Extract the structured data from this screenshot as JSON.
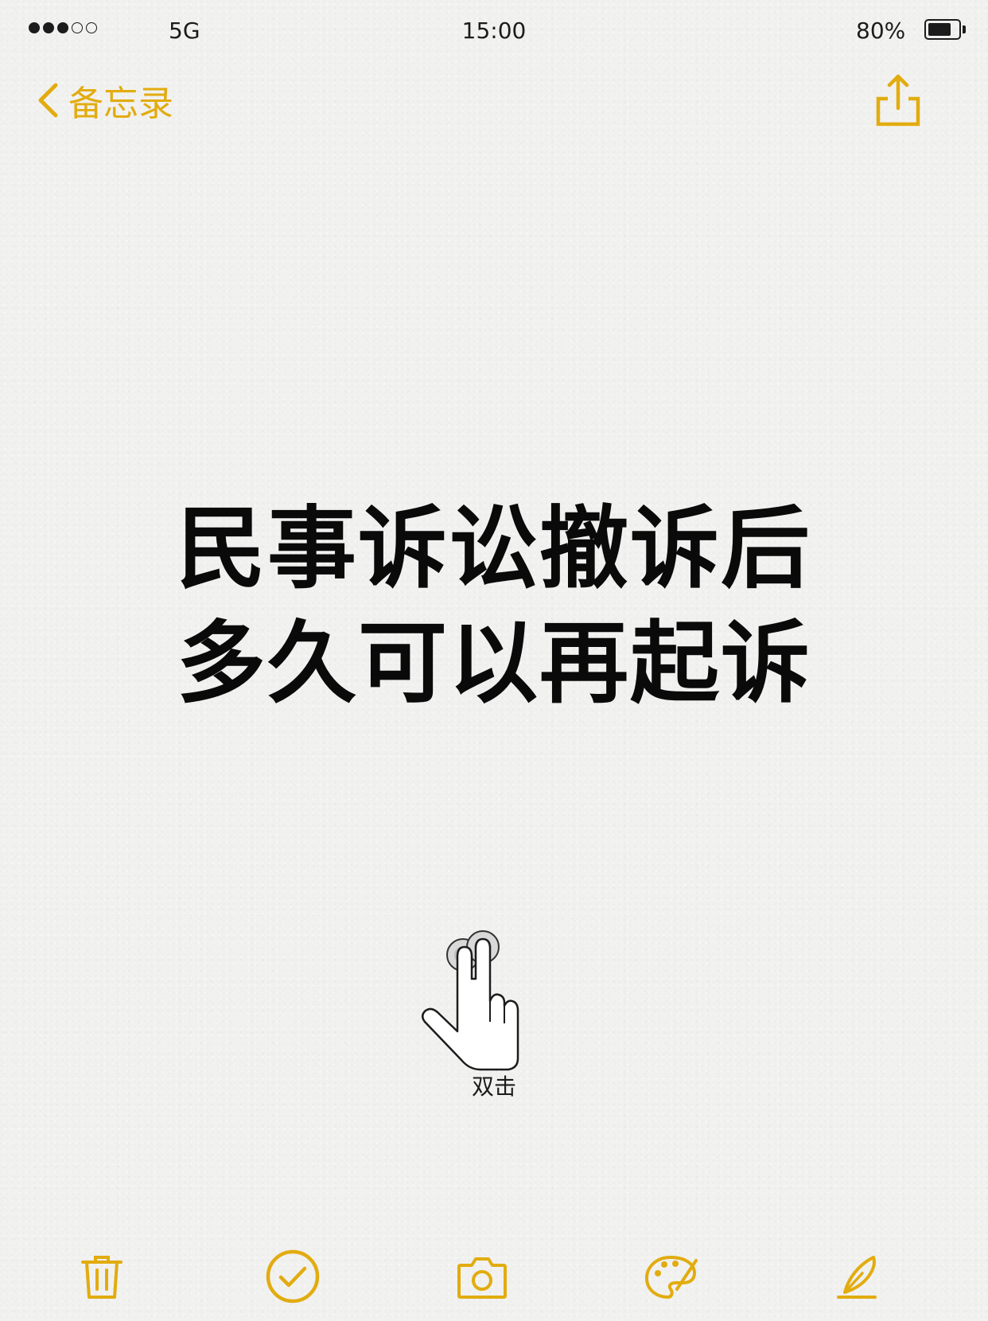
{
  "status_bar": {
    "signal_bars_on": 3,
    "signal_bars_total": 5,
    "carrier": "5G",
    "time": "15:00",
    "battery_percent_label": "80%",
    "battery_level": 0.8
  },
  "nav": {
    "back_label": "备忘录",
    "back_icon": "chevron-left-icon",
    "share_icon": "share-icon"
  },
  "note": {
    "title_line1": "民事诉讼撤诉后",
    "title_line2": "多久可以再起诉"
  },
  "hint": {
    "icon": "double-tap-hand-icon",
    "label": "双击"
  },
  "toolbar": {
    "items": [
      "trash-icon",
      "checklist-icon",
      "camera-icon",
      "palette-icon",
      "pen-icon"
    ]
  },
  "colors": {
    "accent": "#e2ac0f",
    "text": "#0a0a0a",
    "background": "#f1f1f0"
  }
}
